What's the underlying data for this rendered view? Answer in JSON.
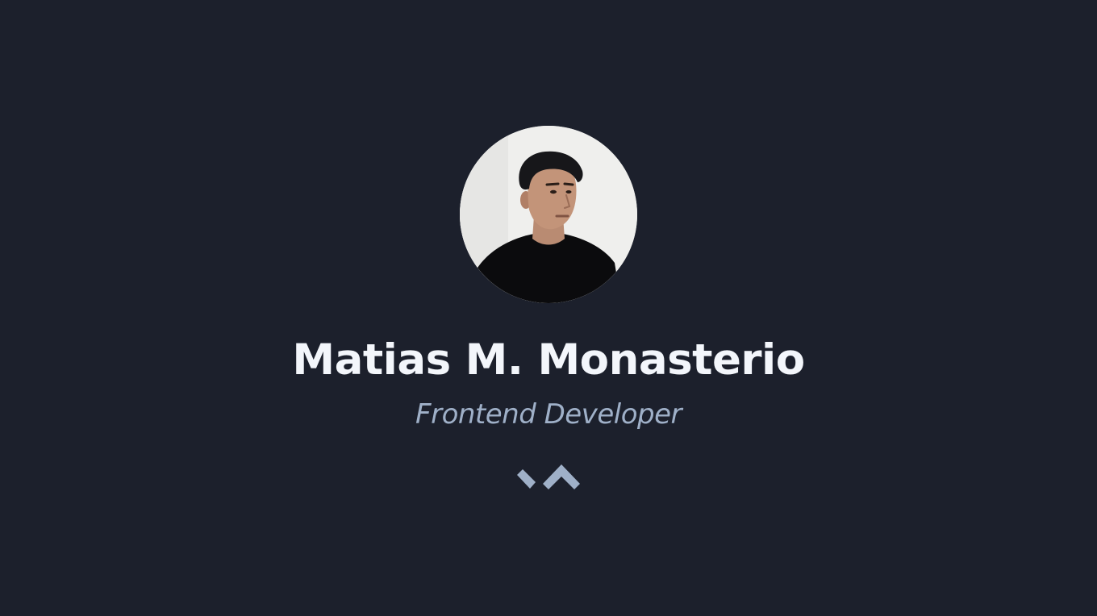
{
  "profile": {
    "name": "Matias M. Monasterio",
    "role": "Frontend Developer",
    "avatar_icon": "profile-photo"
  },
  "scroll_hint": {
    "icon": "chevron-up-icon"
  },
  "colors": {
    "background": "#1c202c",
    "name_text": "#f3f6fb",
    "role_text": "#9fb0c8",
    "chevron": "#9fb0c8"
  }
}
